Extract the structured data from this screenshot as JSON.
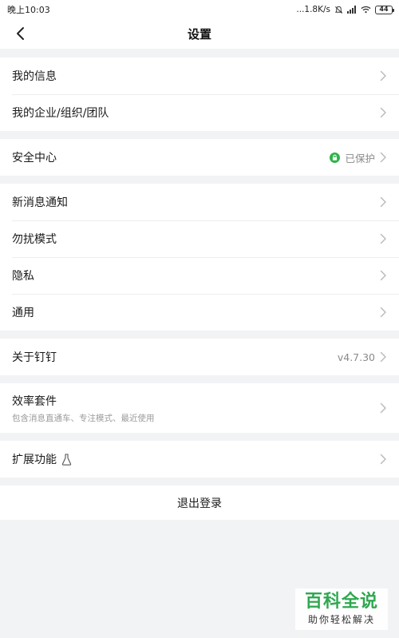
{
  "status_bar": {
    "time": "晚上10:03",
    "net_speed": "...1.8K/s",
    "battery": "44"
  },
  "header": {
    "title": "设置"
  },
  "groups": [
    {
      "items": [
        {
          "label": "我的信息"
        },
        {
          "label": "我的企业/组织/团队"
        }
      ]
    },
    {
      "items": [
        {
          "label": "安全中心",
          "value": "已保护"
        }
      ]
    },
    {
      "items": [
        {
          "label": "新消息通知"
        },
        {
          "label": "勿扰模式"
        },
        {
          "label": "隐私"
        },
        {
          "label": "通用"
        }
      ]
    },
    {
      "items": [
        {
          "label": "关于钉钉",
          "value": "v4.7.30"
        }
      ]
    },
    {
      "items": [
        {
          "label": "效率套件",
          "subtitle": "包含消息直通车、专注模式、最近使用"
        }
      ]
    },
    {
      "items": [
        {
          "label": "扩展功能"
        }
      ]
    }
  ],
  "logout": {
    "label": "退出登录"
  },
  "watermark": {
    "main": "百科全说",
    "sub": "助你轻松解决"
  },
  "colors": {
    "background": "#f2f3f5",
    "lock_green": "#2fb24c",
    "watermark_green": "#2fa84f"
  },
  "icons": {
    "back": "chevron-left-icon",
    "row_arrow": "chevron-right-icon",
    "protected": "lock-icon",
    "extension": "flask-icon"
  }
}
